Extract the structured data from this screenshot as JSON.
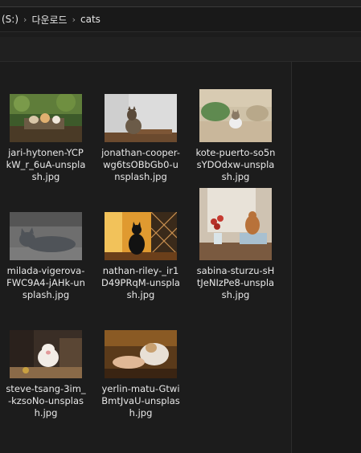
{
  "breadcrumb": {
    "drive": "(S:)",
    "folder1": "다운로드",
    "folder2": "cats"
  },
  "files": [
    {
      "name": "jari-hytonen-YCPkW_r_6uA-unsplash.jpg",
      "thumb": "garden-cats"
    },
    {
      "name": "jonathan-cooper-wg6tsOBbGb0-unsplash.jpg",
      "thumb": "tabby-on-shelf"
    },
    {
      "name": "kote-puerto-so5nsYDOdxw-unsplash.jpg",
      "thumb": "kitten-on-sofa"
    },
    {
      "name": "milada-vigerova-FWC9A4-jAHk-unsplash.jpg",
      "thumb": "grey-cat-lying"
    },
    {
      "name": "nathan-riley-_ir1D49PRqM-unsplash.jpg",
      "thumb": "black-cat-window"
    },
    {
      "name": "sabina-sturzu-sHtJeNIzPe8-unsplash.jpg",
      "thumb": "cat-with-flowers"
    },
    {
      "name": "steve-tsang-3im_-kzsoNo-unsplash.jpg",
      "thumb": "kitten-yawning"
    },
    {
      "name": "yerlin-matu-GtwiBmtJvaU-unsplash.jpg",
      "thumb": "hand-petting-cat"
    }
  ]
}
